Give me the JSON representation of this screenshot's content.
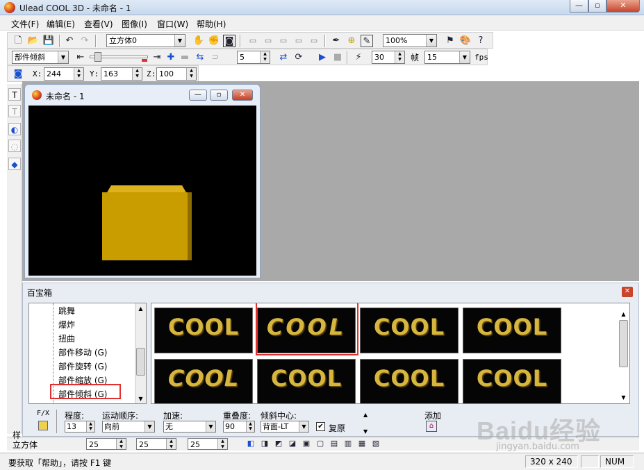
{
  "window": {
    "title": "Ulead COOL 3D - 未命名 - 1"
  },
  "menu": [
    "文件(F)",
    "编辑(E)",
    "查看(V)",
    "图像(I)",
    "窗口(W)",
    "帮助(H)"
  ],
  "toolbar1": {
    "object_select": "立方体0",
    "zoom": "100%"
  },
  "toolbar2": {
    "effect_select": "部件倾斜",
    "frame_spin": "5",
    "fps_value": "30",
    "frames_label": "帧",
    "frames_value": "15",
    "fps_label": "fps"
  },
  "toolbar3": {
    "x_label": "X:",
    "x_value": "244",
    "y_label": "Y:",
    "y_value": "163",
    "z_label": "Z:",
    "z_value": "100"
  },
  "child_window": {
    "title": "未命名 - 1"
  },
  "panel": {
    "title": "百宝箱",
    "tree_items": [
      "跳舞",
      "爆炸",
      "扭曲",
      "部件移动 (G)",
      "部件旋转 (G)",
      "部件缩放 (G)",
      "部件倾斜 (G)"
    ],
    "selected_tree_item": "部件倾斜 (G)",
    "thumbnails": [
      "COOL",
      "COOL",
      "COOL",
      "COOL",
      "COOL",
      "COOL",
      "COOL",
      "COOL"
    ],
    "props": {
      "fx_label": "F/X",
      "degree_label": "程度:",
      "degree_value": "13",
      "order_label": "运动顺序:",
      "order_value": "向前",
      "accel_label": "加速:",
      "accel_value": "无",
      "overlap_label": "重叠度:",
      "overlap_value": "90",
      "center_label": "倾斜中心:",
      "center_value": "背面-LT",
      "restore_label": "复原",
      "add_label": "添加"
    }
  },
  "bottombar": {
    "tab_label": "样",
    "object_label": "立方体",
    "v1": "25",
    "v2": "25",
    "v3": "25"
  },
  "status": {
    "help_text": "要获取「帮助」，请按 F1 键",
    "size": "320 x 240",
    "num": "NUM"
  },
  "watermark": {
    "logo": "Baidu经验",
    "url": "jingyan.baidu.com"
  }
}
